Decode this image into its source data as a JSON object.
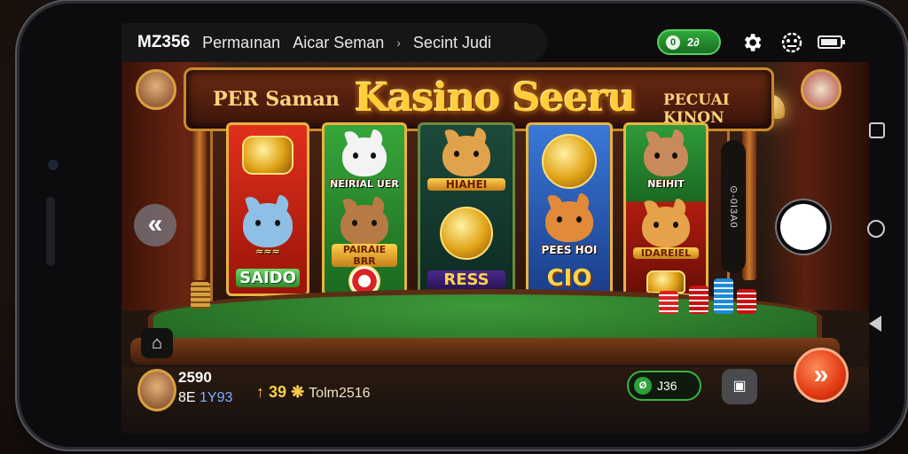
{
  "topbar": {
    "app_title": "MZ356",
    "tabs": [
      {
        "label": "Permaınan"
      },
      {
        "label": "Aicar Seman"
      },
      {
        "label": "Secint Judi"
      }
    ],
    "tab_chevron": "›",
    "coin_pill": {
      "icon": "coin-icon",
      "glyph": "0",
      "value": "2∂"
    },
    "icons": [
      "settings-gear-icon",
      "game-controller-icon",
      "battery-icon"
    ]
  },
  "banner": {
    "left_text": "PER Saman",
    "title": "Kasino Seeru",
    "right_text": "PECUAI KINON"
  },
  "cards": [
    {
      "top_label": "",
      "mid_label": "",
      "bottom_label": "SAIDO"
    },
    {
      "top_label": "NEIRIAL UER",
      "mid_label": "PAIRAIE BRR",
      "bottom_label": ""
    },
    {
      "top_label": "HIAHEI",
      "mid_label": "",
      "bottom_label": "RESS"
    },
    {
      "top_label": "",
      "mid_label": "PEES HOI",
      "bottom_label": "CIO"
    },
    {
      "top_label": "NEIHIT",
      "mid_label": "IDAREIEL",
      "bottom_label": ""
    }
  ],
  "side_panel_text": "⊙-0I3A0",
  "bottom": {
    "balance_main": "2590",
    "balance_sub_prefix": "8E ",
    "balance_sub_highlight": "1Y93",
    "bet_icon": "↑",
    "bet_value": "39",
    "bet_symbol": "❋",
    "bet_sub": "Tolm2516",
    "win_icon_glyph": "Ø",
    "win_value": "J36"
  },
  "colors": {
    "accent_gold": "#ffce3a",
    "felt_green": "#3d9a3a",
    "spin_red": "#e23a12",
    "pill_green": "#2fa83a"
  }
}
